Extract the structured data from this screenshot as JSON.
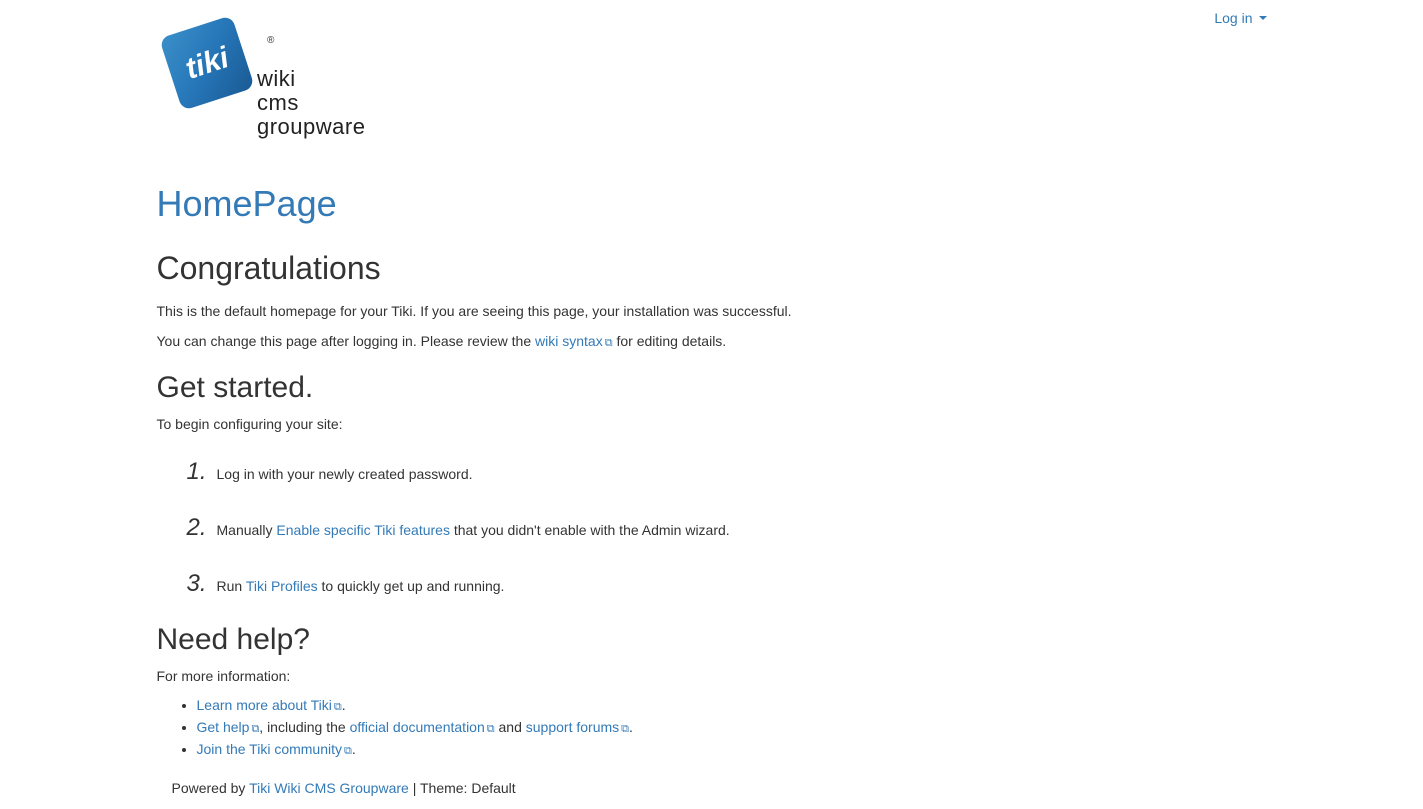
{
  "header": {
    "login_label": "Log in",
    "logo": {
      "brand_text": "tiki",
      "tagline_1": "wiki",
      "tagline_2": "cms",
      "tagline_3": "groupware",
      "registered_mark": "®"
    }
  },
  "page": {
    "title": "HomePage"
  },
  "congrats": {
    "heading": "Congratulations",
    "p1": "This is the default homepage for your Tiki. If you are seeing this page, your installation was successful.",
    "p2_prefix": "You can change this page after logging in. Please review the ",
    "p2_link": "wiki syntax",
    "p2_suffix": " for editing details."
  },
  "getstarted": {
    "heading": "Get started.",
    "intro": "To begin configuring your site:",
    "step1": "Log in with your newly created password.",
    "step2_prefix": "Manually ",
    "step2_link": "Enable specific Tiki features",
    "step2_suffix": " that you didn't enable with the Admin wizard.",
    "step3_prefix": "Run ",
    "step3_link": "Tiki Profiles",
    "step3_suffix": " to quickly get up and running."
  },
  "help": {
    "heading": "Need help?",
    "intro": "For more information:",
    "item1_link": "Learn more about Tiki",
    "item1_suffix": ".",
    "item2_link": "Get help",
    "item2_mid1": ", including the ",
    "item2_link2": "official documentation",
    "item2_mid2": " and ",
    "item2_link3": "support forums",
    "item2_suffix": ".",
    "item3_link": "Join the Tiki community",
    "item3_suffix": "."
  },
  "footer": {
    "powered_prefix": "Powered by ",
    "powered_link": "Tiki Wiki CMS Groupware",
    "theme_text": "  | Theme: Default"
  }
}
